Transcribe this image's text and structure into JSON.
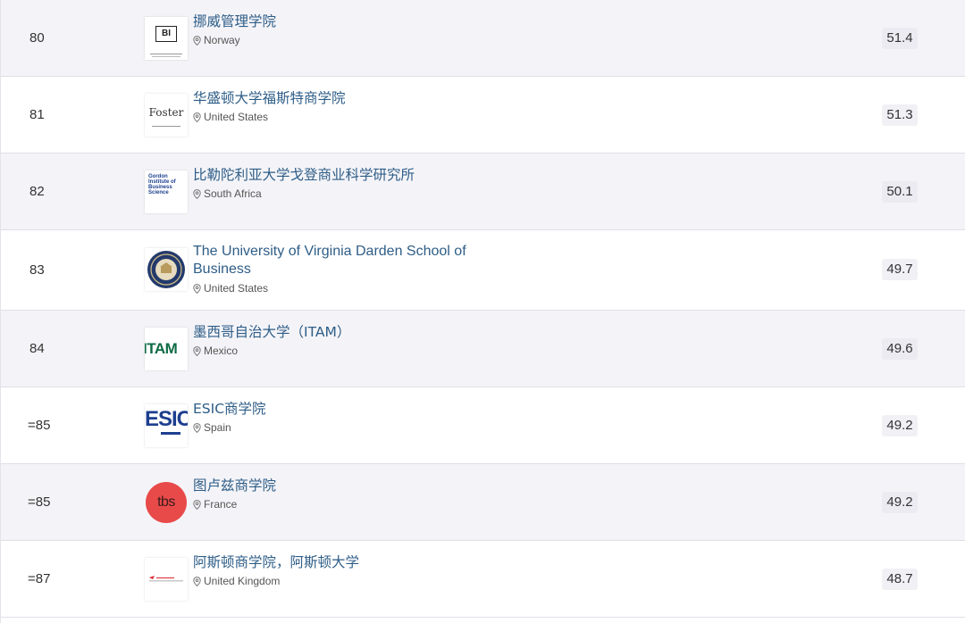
{
  "rankings": [
    {
      "rank": "80",
      "name": "挪威管理学院",
      "location": "Norway",
      "score": "51.4",
      "logo_label": "BI"
    },
    {
      "rank": "81",
      "name": "华盛顿大学福斯特商学院",
      "location": "United States",
      "score": "51.3",
      "logo_label": "Foster"
    },
    {
      "rank": "82",
      "name": "比勒陀利亚大学戈登商业科学研究所",
      "location": "South Africa",
      "score": "50.1",
      "logo_label": "Gordon Institute of Business Science"
    },
    {
      "rank": "83",
      "name": "The University of Virginia Darden School of Business",
      "location": "United States",
      "score": "49.7",
      "logo_label": ""
    },
    {
      "rank": "84",
      "name": "墨西哥自治大学（ITAM）",
      "location": "Mexico",
      "score": "49.6",
      "logo_label": "ITAM"
    },
    {
      "rank": "=85",
      "name": "ESIC商学院",
      "location": "Spain",
      "score": "49.2",
      "logo_label": "ESIC"
    },
    {
      "rank": "=85",
      "name": "图卢兹商学院",
      "location": "France",
      "score": "49.2",
      "logo_label": "tbs"
    },
    {
      "rank": "=87",
      "name": "阿斯顿商学院，阿斯顿大学",
      "location": "United Kingdom",
      "score": "48.7",
      "logo_label": ""
    }
  ],
  "colors": {
    "link": "#2e5d87",
    "row_shade": "#f4f4f8",
    "tbs_red": "#e84a4a",
    "itam_green": "#0f6b45",
    "esic_blue": "#1d3f8f"
  },
  "icons": {
    "location": "location-pin-icon"
  }
}
